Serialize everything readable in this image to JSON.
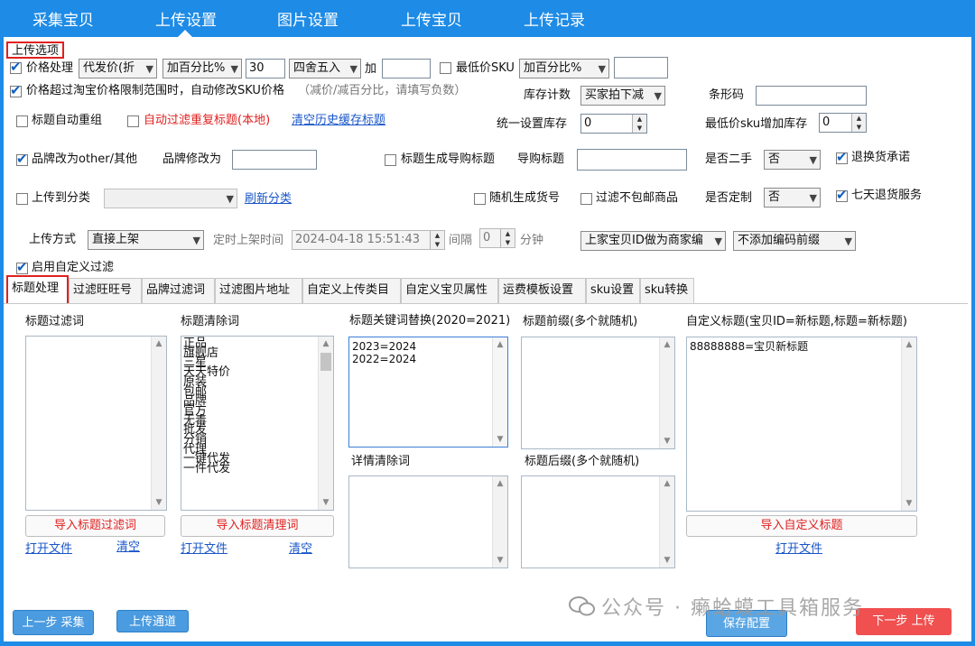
{
  "nav": {
    "tabs": [
      "采集宝贝",
      "上传设置",
      "图片设置",
      "上传宝贝",
      "上传记录"
    ]
  },
  "options": {
    "group_title": "上传选项",
    "price_processing": "价格处理",
    "price_base": "代发价(折",
    "price_mode": "加百分比%",
    "price_value": "30",
    "rounding": "四舍五入",
    "add_label": "加",
    "add_value": "",
    "min_price_sku": "最低价SKU",
    "min_mode": "加百分比%",
    "min_value": "",
    "over_limit": "价格超过淘宝价格限制范围时，自动修改SKU价格",
    "over_limit_hint": "（减价/减百分比，请填写负数）",
    "stock_count_label": "库存计数",
    "stock_count": "买家拍下减",
    "barcode_label": "条形码",
    "barcode_value": "",
    "title_regroup": "标题自动重组",
    "auto_filter_dup": "自动过滤重复标题(本地)",
    "clear_history": "清空历史缓存标题",
    "uniform_stock_label": "统一设置库存",
    "uniform_stock": "0",
    "min_sku_stock_label": "最低价sku增加库存",
    "min_sku_stock": "0",
    "brand_other": "品牌改为other/其他",
    "brand_change_label": "品牌修改为",
    "brand_change_value": "",
    "gen_guide_title": "标题生成导购标题",
    "guide_title_label": "导购标题",
    "guide_title_value": "",
    "second_hand_label": "是否二手",
    "second_hand": "否",
    "return_promise": "退换货承诺",
    "upload_category": "上传到分类",
    "category_value": "",
    "refresh_category": "刷新分类",
    "random_item_no": "随机生成货号",
    "filter_no_shipping": "过滤不包邮商品",
    "custom_made_label": "是否定制",
    "custom_made": "否",
    "seven_day_return": "七天退货服务",
    "upload_method_label": "上传方式",
    "upload_method": "直接上架",
    "scheduled_label": "定时上架时间",
    "scheduled_time": "2024-04-18 15:51:43",
    "interval_label": "间隔",
    "interval_value": "0",
    "minute_label": "分钟",
    "merchant_code": "上家宝贝ID做为商家编",
    "prefix_option": "不添加编码前缀",
    "enable_custom_filter": "启用自定义过滤"
  },
  "subtabs": [
    "标题处理",
    "过滤旺旺号",
    "品牌过滤词",
    "过滤图片地址",
    "自定义上传类目",
    "自定义宝贝属性",
    "运费模板设置",
    "sku设置",
    "sku转换"
  ],
  "title_panel": {
    "filter_words_label": "标题过滤词",
    "clear_words_label": "标题清除词",
    "clear_words": [
      "正品",
      "旗舰店",
      "三星",
      "天天特价",
      "原装",
      "包邮",
      "品牌",
      "官方",
      "无毒",
      "批发",
      "分销",
      "代理",
      "一键代发",
      "一件代发"
    ],
    "keyword_replace_label": "标题关键词替换(2020=2021)",
    "keyword_replace_text": "2023=2024\n2022=2024",
    "prefix_label": "标题前缀(多个就随机)",
    "custom_title_label": "自定义标题(宝贝ID=新标题,标题=新标题)",
    "custom_title_text": "88888888=宝贝新标题",
    "detail_clear_label": "详情清除词",
    "suffix_label": "标题后缀(多个就随机)",
    "import_filter_btn": "导入标题过滤词",
    "import_clear_btn": "导入标题清理词",
    "import_custom_btn": "导入自定义标题",
    "open_file": "打开文件",
    "clear": "清空"
  },
  "footer": {
    "prev_btn": "上一步 采集",
    "channel_btn": "上传通道",
    "save_btn": "保存配置",
    "next_btn": "下一步 上传"
  },
  "watermark": "公众号 · 癞蛤蟆工具箱服务"
}
